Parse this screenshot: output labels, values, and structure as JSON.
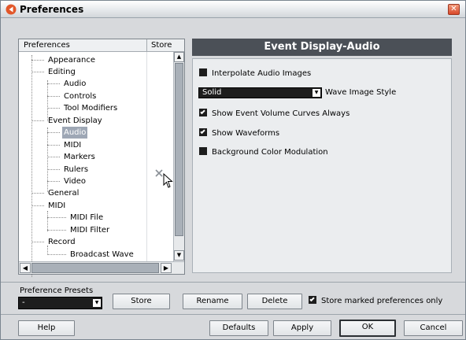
{
  "window": {
    "title": "Preferences",
    "close_glyph": "✕"
  },
  "tree": {
    "header_preferences": "Preferences",
    "header_store": "Store",
    "items": [
      {
        "label": "Appearance"
      },
      {
        "label": "Editing"
      },
      {
        "label": "Audio"
      },
      {
        "label": "Controls"
      },
      {
        "label": "Tool Modifiers"
      },
      {
        "label": "Event Display"
      },
      {
        "label": "Audio",
        "selected": true
      },
      {
        "label": "MIDI"
      },
      {
        "label": "Markers"
      },
      {
        "label": "Rulers"
      },
      {
        "label": "Video"
      },
      {
        "label": "General"
      },
      {
        "label": "MIDI"
      },
      {
        "label": "MIDI File"
      },
      {
        "label": "MIDI Filter"
      },
      {
        "label": "Record"
      },
      {
        "label": "Broadcast Wave"
      }
    ],
    "scroll_up_glyph": "▲",
    "scroll_down_glyph": "▼",
    "scroll_left_glyph": "◀",
    "scroll_right_glyph": "▶"
  },
  "settings": {
    "title": "Event Display-Audio",
    "options": {
      "interpolate": {
        "label": "Interpolate Audio Images",
        "checked": false
      },
      "volume_curves": {
        "label": "Show Event Volume Curves Always",
        "checked": true
      },
      "waveforms": {
        "label": "Show Waveforms",
        "checked": true
      },
      "bg_color": {
        "label": "Background Color Modulation",
        "checked": false
      }
    },
    "wave_style": {
      "value": "Solid",
      "label": "Wave Image Style"
    },
    "dropdown_arrow_glyph": "▼"
  },
  "presets": {
    "label": "Preference Presets",
    "value": "-",
    "store_label": "Store",
    "rename_label": "Rename",
    "delete_label": "Delete",
    "store_marked_label": "Store marked preferences only",
    "store_marked_checked": true
  },
  "footer": {
    "help_label": "Help",
    "defaults_label": "Defaults",
    "apply_label": "Apply",
    "ok_label": "OK",
    "cancel_label": "Cancel"
  },
  "colors": {
    "header_bg": "#4b5057",
    "checkbox": "#1d1d1d",
    "selected_row": "#9ea7b5",
    "app_icon": "#e2572a"
  }
}
